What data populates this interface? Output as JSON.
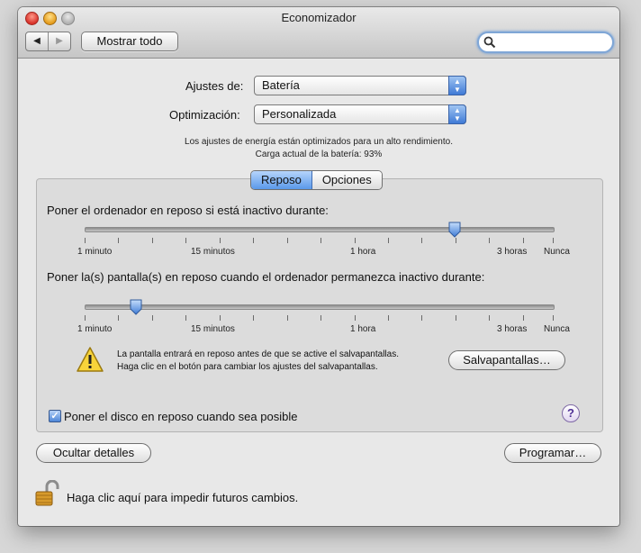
{
  "window": {
    "title": "Economizador"
  },
  "toolbar": {
    "back_label": "◀",
    "forward_label": "▶",
    "show_all_label": "Mostrar todo",
    "search_placeholder": ""
  },
  "settings": {
    "settings_for_label": "Ajustes de:",
    "settings_for_value": "Batería",
    "optimization_label": "Optimización:",
    "optimization_value": "Personalizada",
    "info_line1": "Los ajustes de energía están optimizados para un alto rendimiento.",
    "info_line2": "Carga actual de la batería: 93%"
  },
  "tabs": [
    {
      "label": "Reposo",
      "selected": true
    },
    {
      "label": "Opciones",
      "selected": false
    }
  ],
  "sleep": {
    "computer_label": "Poner el ordenador en reposo si está inactivo durante:",
    "display_label": "Poner la(s) pantalla(s) en reposo cuando el ordenador permanezca inactivo durante:",
    "tick_labels": {
      "min1": "1 minuto",
      "min15": "15 minutos",
      "hour1": "1 hora",
      "hours3": "3 horas",
      "never": "Nunca"
    },
    "computer_slider_value": 0.79,
    "display_slider_value": 0.11,
    "warning_line1": "La pantalla entrará en reposo antes de que se active el salvapantallas.",
    "warning_line2": "Haga clic en el botón para cambiar los ajustes del salvapantallas.",
    "screensaver_button": "Salvapantallas…",
    "disk_sleep_label": "Poner el disco en reposo cuando sea posible",
    "disk_sleep_checked": true,
    "help_label": "?"
  },
  "footer": {
    "hide_details_button": "Ocultar detalles",
    "schedule_button": "Programar…",
    "lock_text": "Haga clic aquí para impedir futuros cambios."
  }
}
